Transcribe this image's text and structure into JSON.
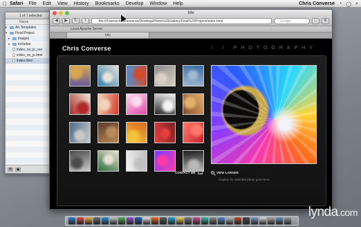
{
  "menubar": {
    "app": "Safari",
    "items": [
      "File",
      "Edit",
      "View",
      "History",
      "Bookmarks",
      "Develop",
      "Window",
      "Help"
    ],
    "user": "Chris Converse"
  },
  "finder": {
    "title": "1 of 7 selected",
    "column_header": "Name",
    "items": [
      {
        "label": "Art Templates",
        "kind": "folder"
      },
      {
        "label": "Final Project",
        "kind": "folder"
      },
      {
        "label": "images",
        "kind": "folder"
      },
      {
        "label": "includes",
        "kind": "folder"
      },
      {
        "label": "index_no_js_css",
        "kind": "file"
      },
      {
        "label": "index_no_js.html",
        "kind": "file"
      },
      {
        "label": "index.html",
        "kind": "file"
      }
    ]
  },
  "safari": {
    "window_title": "title",
    "address": "file:///Users/chrisconverse/Desktop/Photo%20Gallery/Final%20Project/index.html",
    "search_placeholder": "Google",
    "bookmarks": [
      "Local Apache Server"
    ],
    "tab_label": "title"
  },
  "page": {
    "brand": "Chris Converse",
    "section": "/ /  PHOTOGRAPHY",
    "contact_label": "CONTACT ME",
    "view_larger_label": "VIEW LARGER",
    "caption": "Caption for selected photo goes here"
  },
  "thumbnails": [
    {
      "name": "thumb-1",
      "colors": [
        "#6a5a9a",
        "#d6a64e"
      ]
    },
    {
      "name": "thumb-2",
      "colors": [
        "#2f7fb0",
        "#e7e2d8"
      ]
    },
    {
      "name": "thumb-3",
      "colors": [
        "#4f8fd4",
        "#d24a2c"
      ]
    },
    {
      "name": "thumb-4",
      "colors": [
        "#8a8a8a",
        "#d8d0c4"
      ]
    },
    {
      "name": "thumb-5",
      "colors": [
        "#3b6fa8",
        "#9fb8d0"
      ]
    },
    {
      "name": "thumb-6",
      "colors": [
        "#e9e1d0",
        "#b02a2a"
      ]
    },
    {
      "name": "thumb-7",
      "colors": [
        "#d63b2b",
        "#f1d3b8"
      ]
    },
    {
      "name": "thumb-8",
      "colors": [
        "#e14aa9",
        "#ffd9ef"
      ]
    },
    {
      "name": "thumb-9",
      "colors": [
        "#2b2b2b",
        "#f2f2f2"
      ]
    },
    {
      "name": "thumb-10",
      "colors": [
        "#8a4a2c",
        "#e2b06a"
      ]
    },
    {
      "name": "thumb-11",
      "colors": [
        "#4e6c8a",
        "#c8c8c8"
      ]
    },
    {
      "name": "thumb-12",
      "colors": [
        "#5a3a2a",
        "#b88a5a"
      ]
    },
    {
      "name": "thumb-13",
      "colors": [
        "#d86a1c",
        "#f3c33a"
      ]
    },
    {
      "name": "thumb-14",
      "colors": [
        "#7a2222",
        "#e63e3e"
      ]
    },
    {
      "name": "thumb-15",
      "colors": [
        "#c71e2e",
        "#ff7a6a"
      ]
    },
    {
      "name": "thumb-16",
      "colors": [
        "#c8c8c8",
        "#4c4c4c"
      ]
    },
    {
      "name": "thumb-17",
      "colors": [
        "#2b6f3f",
        "#e8e0d0"
      ]
    },
    {
      "name": "thumb-18",
      "colors": [
        "#f2f2f2",
        "#bfbfbf"
      ]
    },
    {
      "name": "thumb-19",
      "colors": [
        "#7a3cff",
        "#ff3aa6"
      ]
    },
    {
      "name": "thumb-20",
      "colors": [
        "#1a1a1a",
        "#b8b8b8"
      ]
    }
  ],
  "dock": {
    "colors": [
      "#3a7bd5",
      "#e24c3c",
      "#f2a93b",
      "#6c6c6c",
      "#2f8fd8",
      "#c7c7c7",
      "#4fb34f",
      "#9a4fd1",
      "#1e5fb0",
      "#e7e7e7",
      "#f06a1e",
      "#5a5a5a",
      "#2aa0d6",
      "#f6d54a",
      "#7e7e7e",
      "#d14c91",
      "#3fb9a8",
      "#8a8a8a",
      "#5887c6",
      "#b9b9b9",
      "#c14a2f",
      "#4a4a4a",
      "#7d9bc2",
      "#dcdcdc",
      "#a6a6a6",
      "#6d8fb7",
      "#999999"
    ]
  },
  "watermark": {
    "name": "lynda",
    "tld": ".com"
  }
}
